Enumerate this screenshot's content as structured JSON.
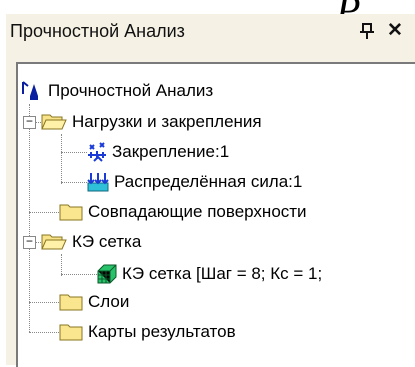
{
  "background_glyph": "P",
  "panel": {
    "title": "Прочностной Анализ",
    "pin_icon": "pin-icon",
    "close_label": "✕"
  },
  "tree": {
    "root": {
      "label": "Прочностной Анализ",
      "icon": "analysis-icon"
    },
    "items": [
      {
        "label": "Нагрузки и закрепления",
        "icon": "folder-open-icon",
        "expanded": true
      },
      {
        "label": "Закрепление:1",
        "icon": "fixture-icon"
      },
      {
        "label": "Распределённая сила:1",
        "icon": "distributed-force-icon"
      },
      {
        "label": "Совпадающие поверхности",
        "icon": "folder-icon"
      },
      {
        "label": "КЭ сетка",
        "icon": "folder-open-icon",
        "expanded": true
      },
      {
        "label": "КЭ сетка [Шаг = 8; Кс = 1;",
        "icon": "mesh-icon"
      },
      {
        "label": "Слои",
        "icon": "folder-icon"
      },
      {
        "label": "Карты результатов",
        "icon": "folder-icon"
      }
    ],
    "expander_symbol": "−"
  }
}
